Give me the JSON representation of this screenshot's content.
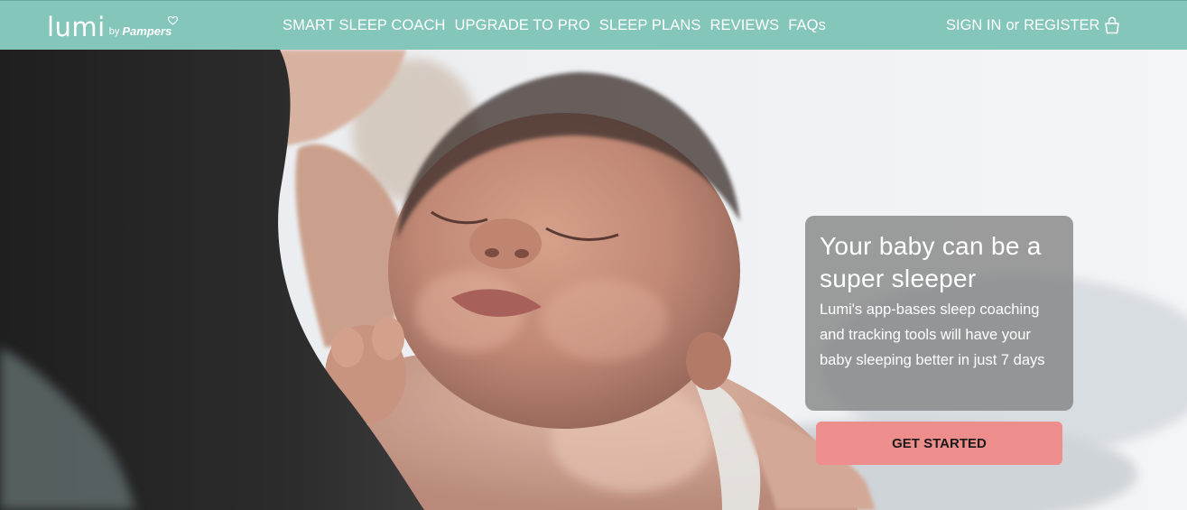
{
  "header": {
    "logo": {
      "brand": "lumi",
      "by": "by",
      "partner": "Pampers"
    },
    "nav": [
      {
        "label": "SMART SLEEP COACH"
      },
      {
        "label": "UPGRADE TO PRO"
      },
      {
        "label": "SLEEP PLANS"
      },
      {
        "label": "REVIEWS"
      },
      {
        "label": "FAQs"
      }
    ],
    "account": {
      "sign_in": "SIGN IN",
      "or": "or",
      "register": "REGISTER",
      "icon": "shopping-bag-icon"
    }
  },
  "hero": {
    "title": "Your baby can be a super sleeper",
    "text": "Lumi's app-bases sleep coaching and tracking tools will have your baby sleeping better in just 7 days",
    "cta_label": "GET STARTED"
  },
  "colors": {
    "header_bg": "#84c6ba",
    "cta_bg": "#ee8e8c",
    "card_bg": "rgba(120,120,120,0.72)"
  }
}
